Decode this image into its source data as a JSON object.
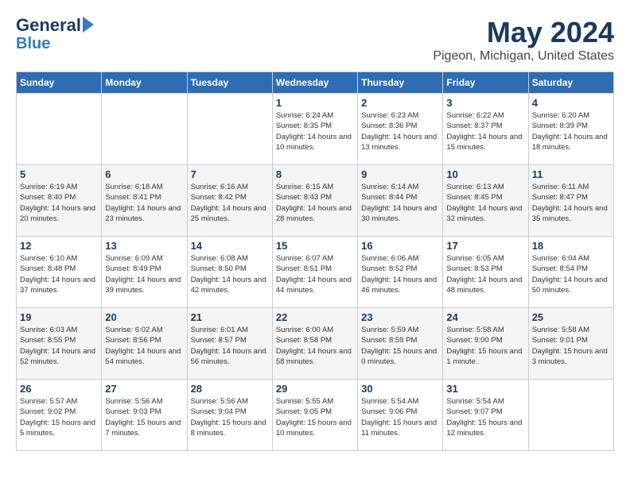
{
  "logo": {
    "line1": "General",
    "line2": "Blue"
  },
  "title": "May 2024",
  "subtitle": "Pigeon, Michigan, United States",
  "weekdays": [
    "Sunday",
    "Monday",
    "Tuesday",
    "Wednesday",
    "Thursday",
    "Friday",
    "Saturday"
  ],
  "weeks": [
    [
      {
        "day": "",
        "content": ""
      },
      {
        "day": "",
        "content": ""
      },
      {
        "day": "",
        "content": ""
      },
      {
        "day": "1",
        "content": "Sunrise: 6:24 AM\nSunset: 8:35 PM\nDaylight: 14 hours\nand 10 minutes."
      },
      {
        "day": "2",
        "content": "Sunrise: 6:23 AM\nSunset: 8:36 PM\nDaylight: 14 hours\nand 13 minutes."
      },
      {
        "day": "3",
        "content": "Sunrise: 6:22 AM\nSunset: 8:37 PM\nDaylight: 14 hours\nand 15 minutes."
      },
      {
        "day": "4",
        "content": "Sunrise: 6:20 AM\nSunset: 8:39 PM\nDaylight: 14 hours\nand 18 minutes."
      }
    ],
    [
      {
        "day": "5",
        "content": "Sunrise: 6:19 AM\nSunset: 8:40 PM\nDaylight: 14 hours\nand 20 minutes."
      },
      {
        "day": "6",
        "content": "Sunrise: 6:18 AM\nSunset: 8:41 PM\nDaylight: 14 hours\nand 23 minutes."
      },
      {
        "day": "7",
        "content": "Sunrise: 6:16 AM\nSunset: 8:42 PM\nDaylight: 14 hours\nand 25 minutes."
      },
      {
        "day": "8",
        "content": "Sunrise: 6:15 AM\nSunset: 8:43 PM\nDaylight: 14 hours\nand 28 minutes."
      },
      {
        "day": "9",
        "content": "Sunrise: 6:14 AM\nSunset: 8:44 PM\nDaylight: 14 hours\nand 30 minutes."
      },
      {
        "day": "10",
        "content": "Sunrise: 6:13 AM\nSunset: 8:45 PM\nDaylight: 14 hours\nand 32 minutes."
      },
      {
        "day": "11",
        "content": "Sunrise: 6:11 AM\nSunset: 8:47 PM\nDaylight: 14 hours\nand 35 minutes."
      }
    ],
    [
      {
        "day": "12",
        "content": "Sunrise: 6:10 AM\nSunset: 8:48 PM\nDaylight: 14 hours\nand 37 minutes."
      },
      {
        "day": "13",
        "content": "Sunrise: 6:09 AM\nSunset: 8:49 PM\nDaylight: 14 hours\nand 39 minutes."
      },
      {
        "day": "14",
        "content": "Sunrise: 6:08 AM\nSunset: 8:50 PM\nDaylight: 14 hours\nand 42 minutes."
      },
      {
        "day": "15",
        "content": "Sunrise: 6:07 AM\nSunset: 8:51 PM\nDaylight: 14 hours\nand 44 minutes."
      },
      {
        "day": "16",
        "content": "Sunrise: 6:06 AM\nSunset: 8:52 PM\nDaylight: 14 hours\nand 46 minutes."
      },
      {
        "day": "17",
        "content": "Sunrise: 6:05 AM\nSunset: 8:53 PM\nDaylight: 14 hours\nand 48 minutes."
      },
      {
        "day": "18",
        "content": "Sunrise: 6:04 AM\nSunset: 8:54 PM\nDaylight: 14 hours\nand 50 minutes."
      }
    ],
    [
      {
        "day": "19",
        "content": "Sunrise: 6:03 AM\nSunset: 8:55 PM\nDaylight: 14 hours\nand 52 minutes."
      },
      {
        "day": "20",
        "content": "Sunrise: 6:02 AM\nSunset: 8:56 PM\nDaylight: 14 hours\nand 54 minutes."
      },
      {
        "day": "21",
        "content": "Sunrise: 6:01 AM\nSunset: 8:57 PM\nDaylight: 14 hours\nand 56 minutes."
      },
      {
        "day": "22",
        "content": "Sunrise: 6:00 AM\nSunset: 8:58 PM\nDaylight: 14 hours\nand 58 minutes."
      },
      {
        "day": "23",
        "content": "Sunrise: 5:59 AM\nSunset: 8:59 PM\nDaylight: 15 hours\nand 0 minutes."
      },
      {
        "day": "24",
        "content": "Sunrise: 5:58 AM\nSunset: 9:00 PM\nDaylight: 15 hours\nand 1 minute."
      },
      {
        "day": "25",
        "content": "Sunrise: 5:58 AM\nSunset: 9:01 PM\nDaylight: 15 hours\nand 3 minutes."
      }
    ],
    [
      {
        "day": "26",
        "content": "Sunrise: 5:57 AM\nSunset: 9:02 PM\nDaylight: 15 hours\nand 5 minutes."
      },
      {
        "day": "27",
        "content": "Sunrise: 5:56 AM\nSunset: 9:03 PM\nDaylight: 15 hours\nand 7 minutes."
      },
      {
        "day": "28",
        "content": "Sunrise: 5:56 AM\nSunset: 9:04 PM\nDaylight: 15 hours\nand 8 minutes."
      },
      {
        "day": "29",
        "content": "Sunrise: 5:55 AM\nSunset: 9:05 PM\nDaylight: 15 hours\nand 10 minutes."
      },
      {
        "day": "30",
        "content": "Sunrise: 5:54 AM\nSunset: 9:06 PM\nDaylight: 15 hours\nand 11 minutes."
      },
      {
        "day": "31",
        "content": "Sunrise: 5:54 AM\nSunset: 9:07 PM\nDaylight: 15 hours\nand 12 minutes."
      },
      {
        "day": "",
        "content": ""
      }
    ]
  ]
}
